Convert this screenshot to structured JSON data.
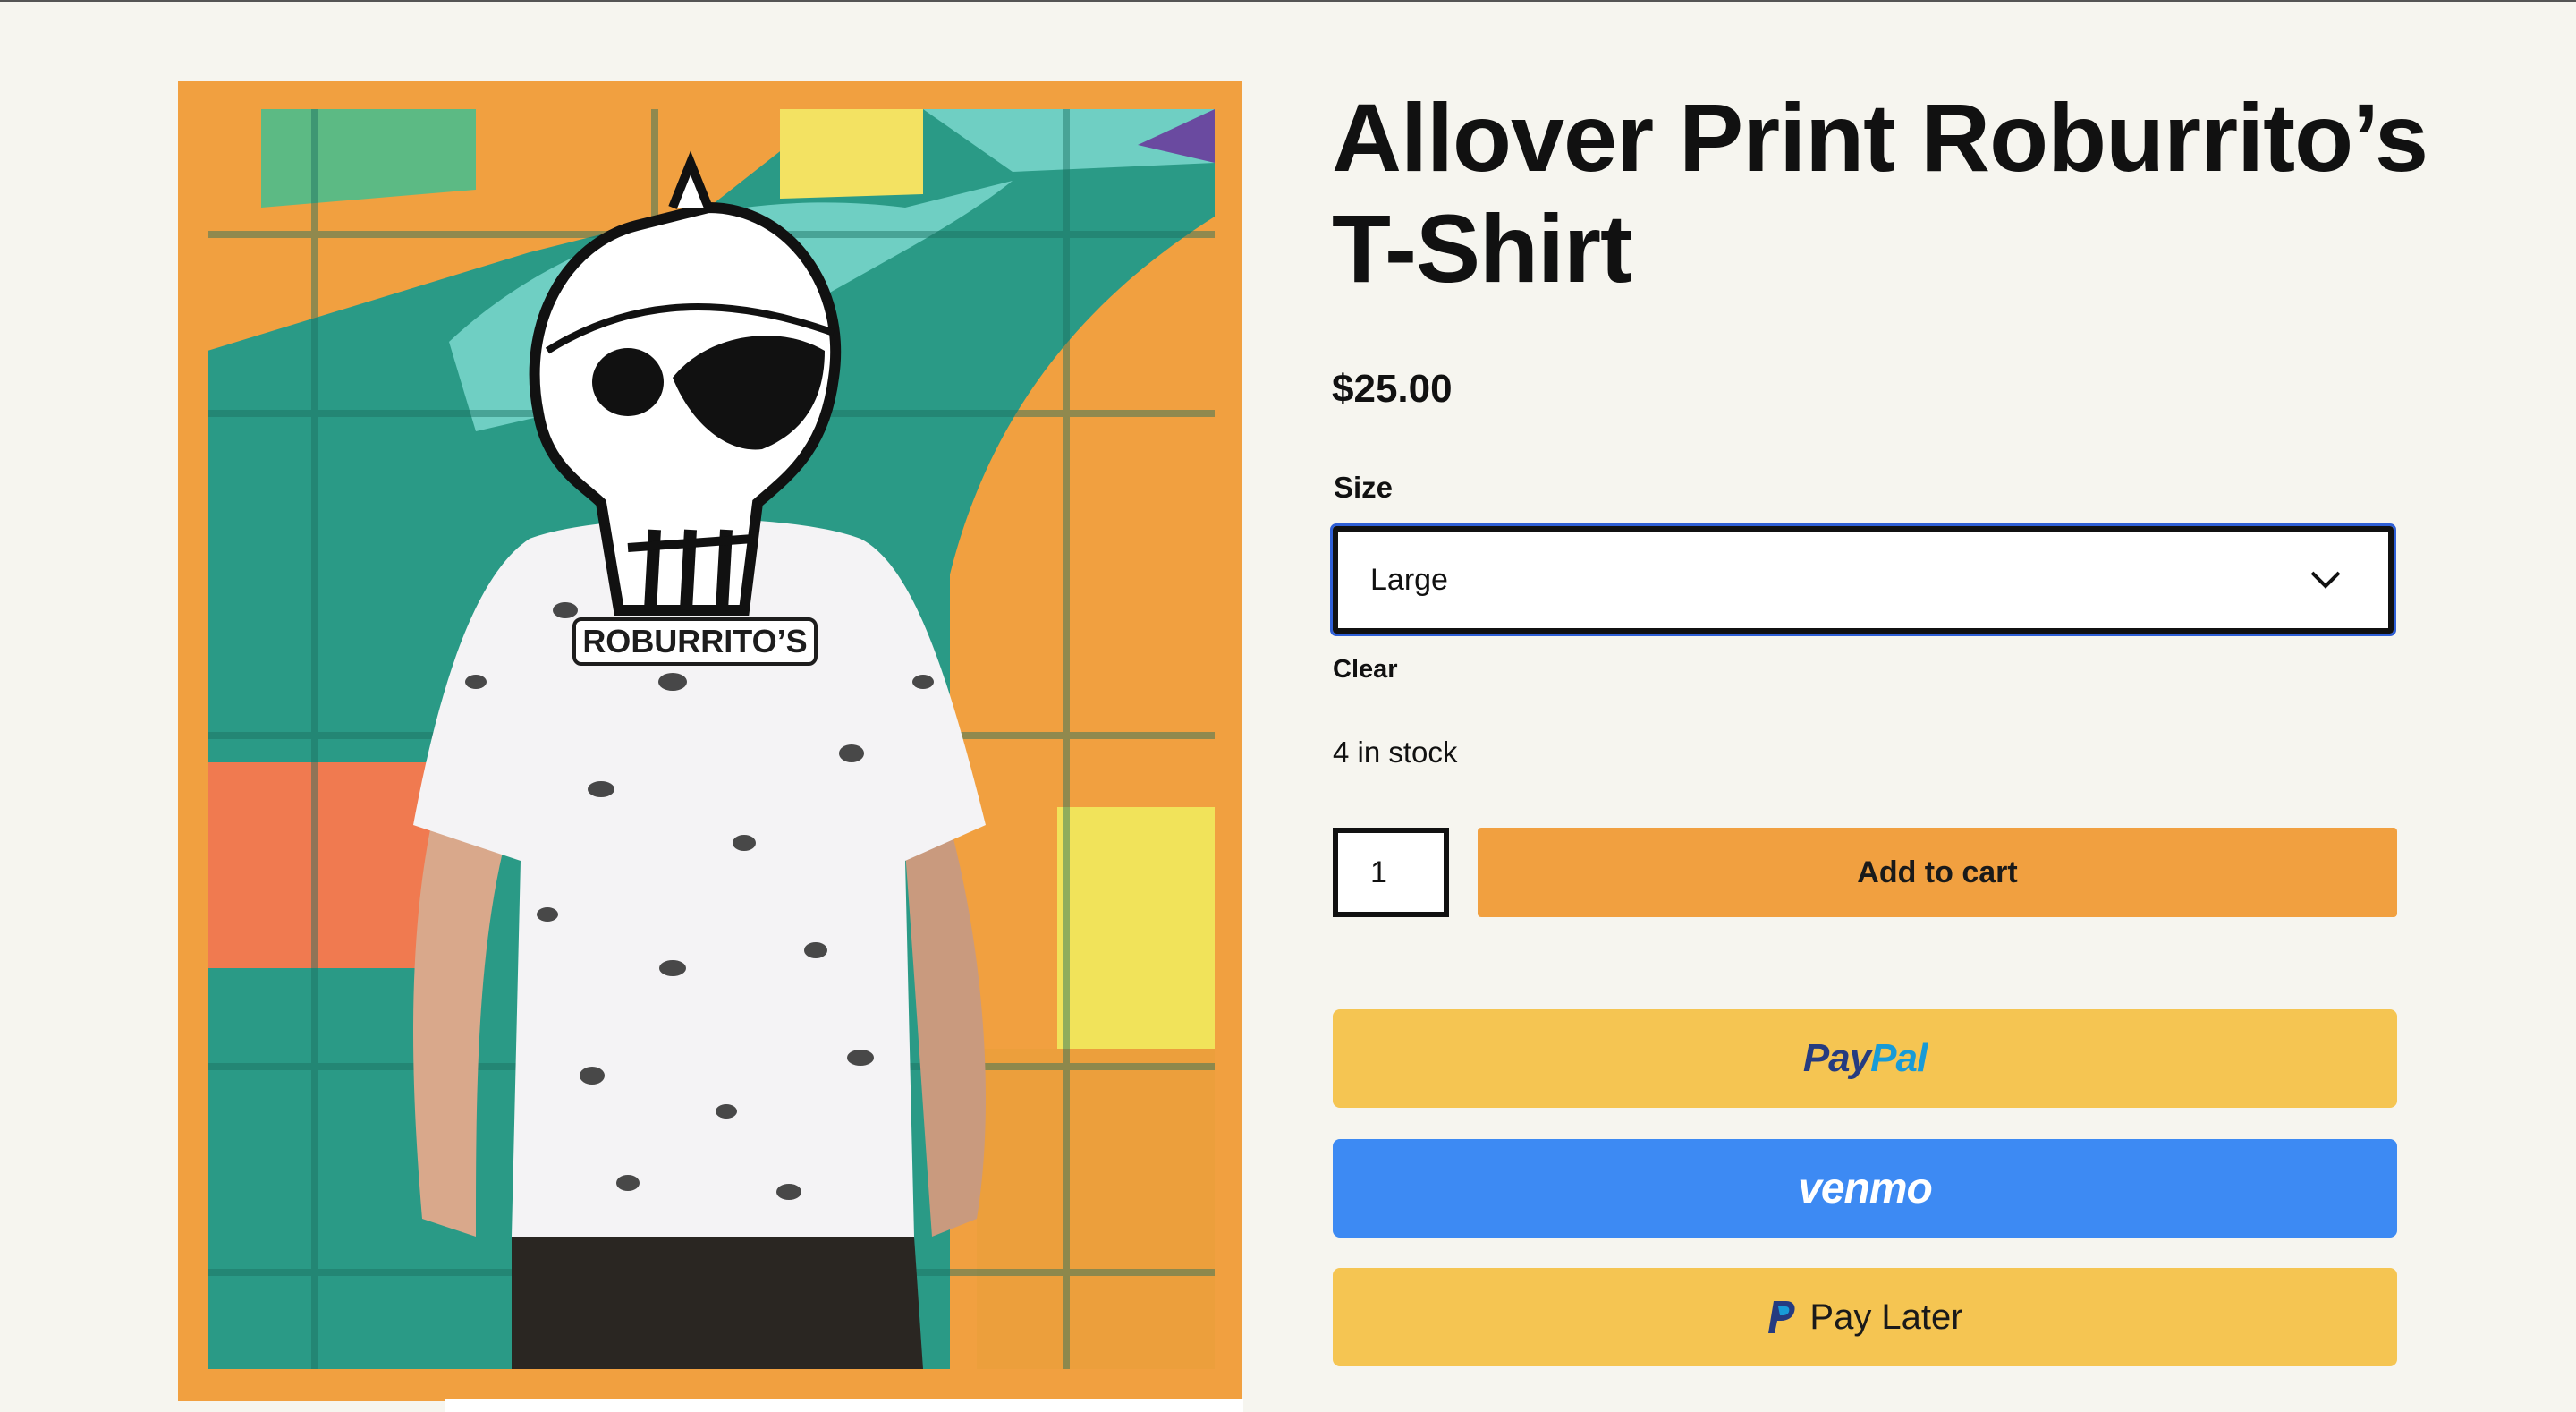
{
  "product": {
    "title": "Allover Print Roburrito’s T-Shirt",
    "price": "$25.00",
    "image_text": "ROBURRITO’S"
  },
  "variation": {
    "size_label": "Size",
    "size_value": "Large",
    "clear_label": "Clear"
  },
  "stock": {
    "text": "4 in stock"
  },
  "cart": {
    "quantity": "1",
    "add_label": "Add to cart"
  },
  "payments": {
    "paypal_part1": "Pay",
    "paypal_part2": "Pal",
    "venmo_label": "venmo",
    "paylater_label": "Pay Later"
  },
  "colors": {
    "accent": "#f1a040",
    "paypal_yellow": "#f5c552",
    "venmo_blue": "#3d8af3",
    "focus_ring": "#2f5fd6"
  },
  "icons": {
    "select_chevron": "chevron-down-icon",
    "paypal_mark": "paypal-p-icon"
  }
}
